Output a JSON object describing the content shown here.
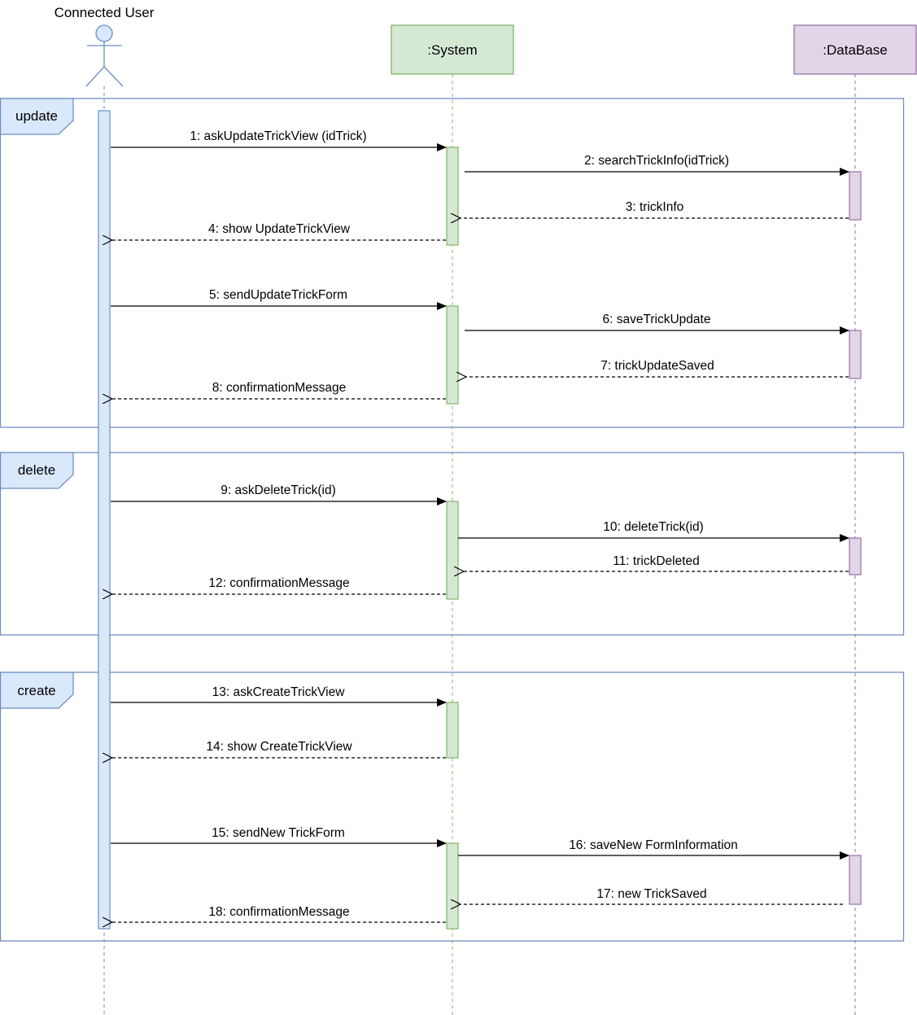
{
  "colors": {
    "actor_line": "#6c8ebf",
    "actor_fill": "#dae8fc",
    "system_line": "#82b366",
    "system_fill": "#d5e8d4",
    "database_line": "#9673a6",
    "database_fill": "#e1d5e7",
    "frame_line": "#6c8ebf",
    "frame_fill": "#dae8fc",
    "arrow": "#000000"
  },
  "participants": {
    "user": {
      "name": "Connected User",
      "kind": "actor"
    },
    "system": {
      "name": ":System",
      "kind": "box"
    },
    "database": {
      "name": ":DataBase",
      "kind": "box"
    }
  },
  "fragments": [
    {
      "label": "update"
    },
    {
      "label": "delete"
    },
    {
      "label": "create"
    }
  ],
  "messages": [
    {
      "label": "1: askUpdateTrickView (idTrick)",
      "type": "call",
      "from": "user",
      "to": "system"
    },
    {
      "label": "2: searchTrickInfo(idTrick)",
      "type": "call",
      "from": "system",
      "to": "database"
    },
    {
      "label": "3: trickInfo",
      "type": "return",
      "from": "database",
      "to": "system"
    },
    {
      "label": "4: show UpdateTrickView",
      "type": "return",
      "from": "system",
      "to": "user"
    },
    {
      "label": "5: sendUpdateTrickForm",
      "type": "call",
      "from": "user",
      "to": "system"
    },
    {
      "label": "6: saveTrickUpdate",
      "type": "call",
      "from": "system",
      "to": "database"
    },
    {
      "label": "7: trickUpdateSaved",
      "type": "return",
      "from": "database",
      "to": "system"
    },
    {
      "label": "8: confirmationMessage",
      "type": "return",
      "from": "system",
      "to": "user"
    },
    {
      "label": "9: askDeleteTrick(id)",
      "type": "call",
      "from": "user",
      "to": "system"
    },
    {
      "label": "10: deleteTrick(id)",
      "type": "call",
      "from": "system",
      "to": "database"
    },
    {
      "label": "11: trickDeleted",
      "type": "return",
      "from": "database",
      "to": "system"
    },
    {
      "label": "12: confirmationMessage",
      "type": "return",
      "from": "system",
      "to": "user"
    },
    {
      "label": "13: askCreateTrickView",
      "type": "call",
      "from": "user",
      "to": "system"
    },
    {
      "label": "14: show CreateTrickView",
      "type": "return",
      "from": "system",
      "to": "user"
    },
    {
      "label": "15: sendNew TrickForm",
      "type": "call",
      "from": "user",
      "to": "system"
    },
    {
      "label": "16: saveNew FormInformation",
      "type": "call",
      "from": "system",
      "to": "database"
    },
    {
      "label": "17: new TrickSaved",
      "type": "return",
      "from": "database",
      "to": "system"
    },
    {
      "label": "18: confirmationMessage",
      "type": "return",
      "from": "system",
      "to": "user"
    }
  ]
}
